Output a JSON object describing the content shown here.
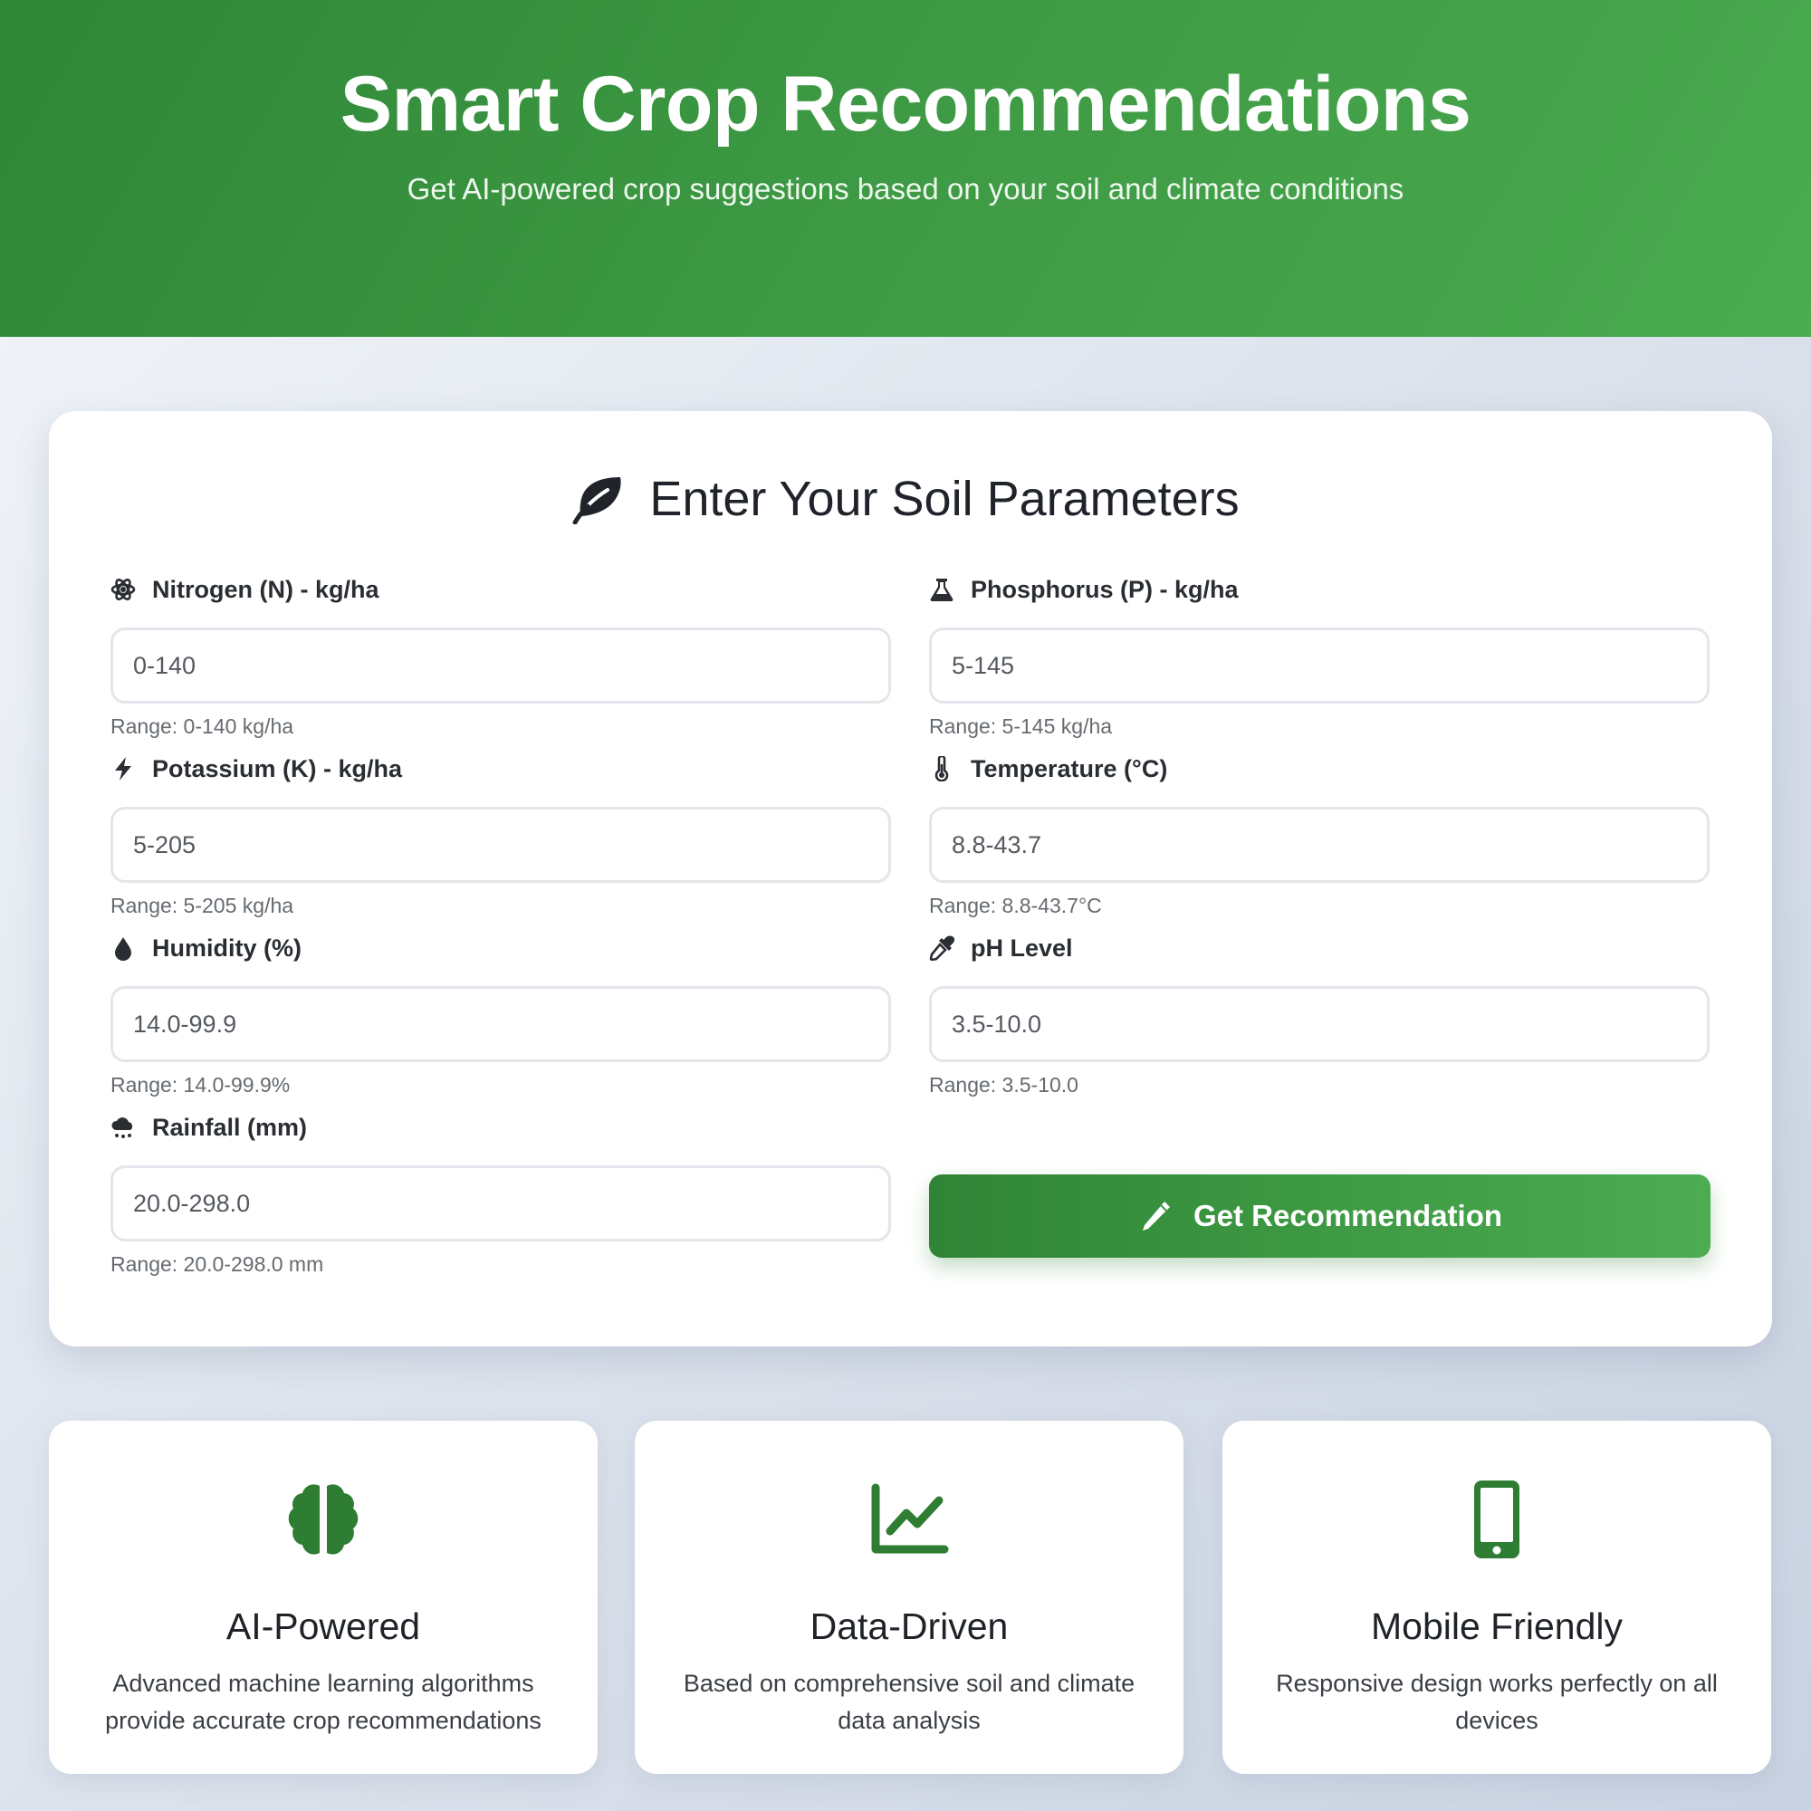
{
  "hero": {
    "title": "Smart Crop Recommendations",
    "subtitle": "Get AI-powered crop suggestions based on your soil and climate conditions"
  },
  "form": {
    "title": "Enter Your Soil Parameters",
    "title_icon": "leaf-icon",
    "fields": [
      {
        "label": "Nitrogen (N) - kg/ha",
        "icon": "atom-icon",
        "placeholder": "0-140",
        "hint": "Range: 0-140 kg/ha"
      },
      {
        "label": "Phosphorus (P) - kg/ha",
        "icon": "flask-icon",
        "placeholder": "5-145",
        "hint": "Range: 5-145 kg/ha"
      },
      {
        "label": "Potassium (K) - kg/ha",
        "icon": "bolt-icon",
        "placeholder": "5-205",
        "hint": "Range: 5-205 kg/ha"
      },
      {
        "label": "Temperature (°C)",
        "icon": "thermometer-icon",
        "placeholder": "8.8-43.7",
        "hint": "Range: 8.8-43.7°C"
      },
      {
        "label": "Humidity (%)",
        "icon": "droplet-icon",
        "placeholder": "14.0-99.9",
        "hint": "Range: 14.0-99.9%"
      },
      {
        "label": "pH Level",
        "icon": "eyedropper-icon",
        "placeholder": "3.5-10.0",
        "hint": "Range: 3.5-10.0"
      },
      {
        "label": "Rainfall (mm)",
        "icon": "cloud-rain-icon",
        "placeholder": "20.0-298.0",
        "hint": "Range: 20.0-298.0 mm"
      }
    ],
    "submit_label": "Get Recommendation",
    "submit_icon": "magic-wand-icon"
  },
  "features": [
    {
      "icon": "brain-icon",
      "title": "AI-Powered",
      "text": "Advanced machine learning algorithms provide accurate crop recommendations"
    },
    {
      "icon": "chart-line-icon",
      "title": "Data-Driven",
      "text": "Based on comprehensive soil and climate data analysis"
    },
    {
      "icon": "mobile-icon",
      "title": "Mobile Friendly",
      "text": "Responsive design works perfectly on all devices"
    }
  ],
  "colors": {
    "primary": "#2e7d32",
    "primary_light": "#4caf50",
    "text_dark": "#1f2328",
    "hint": "#666b70"
  }
}
